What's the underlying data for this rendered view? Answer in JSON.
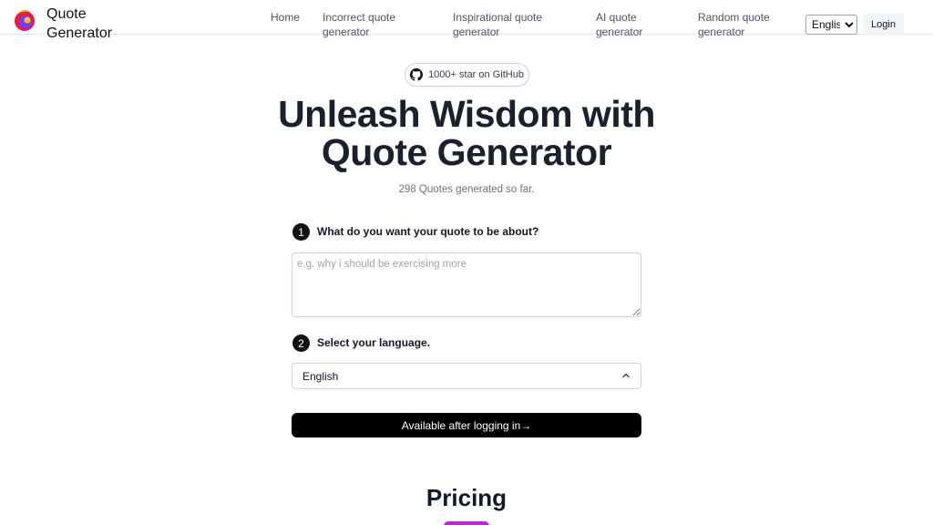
{
  "brand": {
    "name_line1": "Quote",
    "name_line2": "Generator"
  },
  "nav": {
    "home": "Home",
    "incorrect_l1": "Incorrect quote",
    "incorrect_l2": "generator",
    "inspirational_l1": "Inspirational quote",
    "inspirational_l2": "generator",
    "ai_l1": "AI quote",
    "ai_l2": "generator",
    "random_l1": "Random quote",
    "random_l2": "generator"
  },
  "header": {
    "language_selected": "English",
    "login_label": "Login"
  },
  "hero": {
    "github_badge": "1000+ star on GitHub",
    "title_line1": "Unleash Wisdom with",
    "title_line2": "Quote Generator",
    "counter": "298 Quotes generated so far."
  },
  "form": {
    "step1_num": "1",
    "step1_label": "What do you want your quote to be about?",
    "topic_placeholder": "e.g. why i should be exercising more",
    "step2_num": "2",
    "step2_label": "Select your language.",
    "language_value": "English",
    "submit_label": "Available after logging in→"
  },
  "pricing": {
    "title": "Pricing"
  },
  "colors": {
    "accent_pill": "#c026d3",
    "button_bg": "#000000"
  },
  "icons": [
    "logo-icon",
    "github-icon",
    "chevron-up-icon"
  ]
}
